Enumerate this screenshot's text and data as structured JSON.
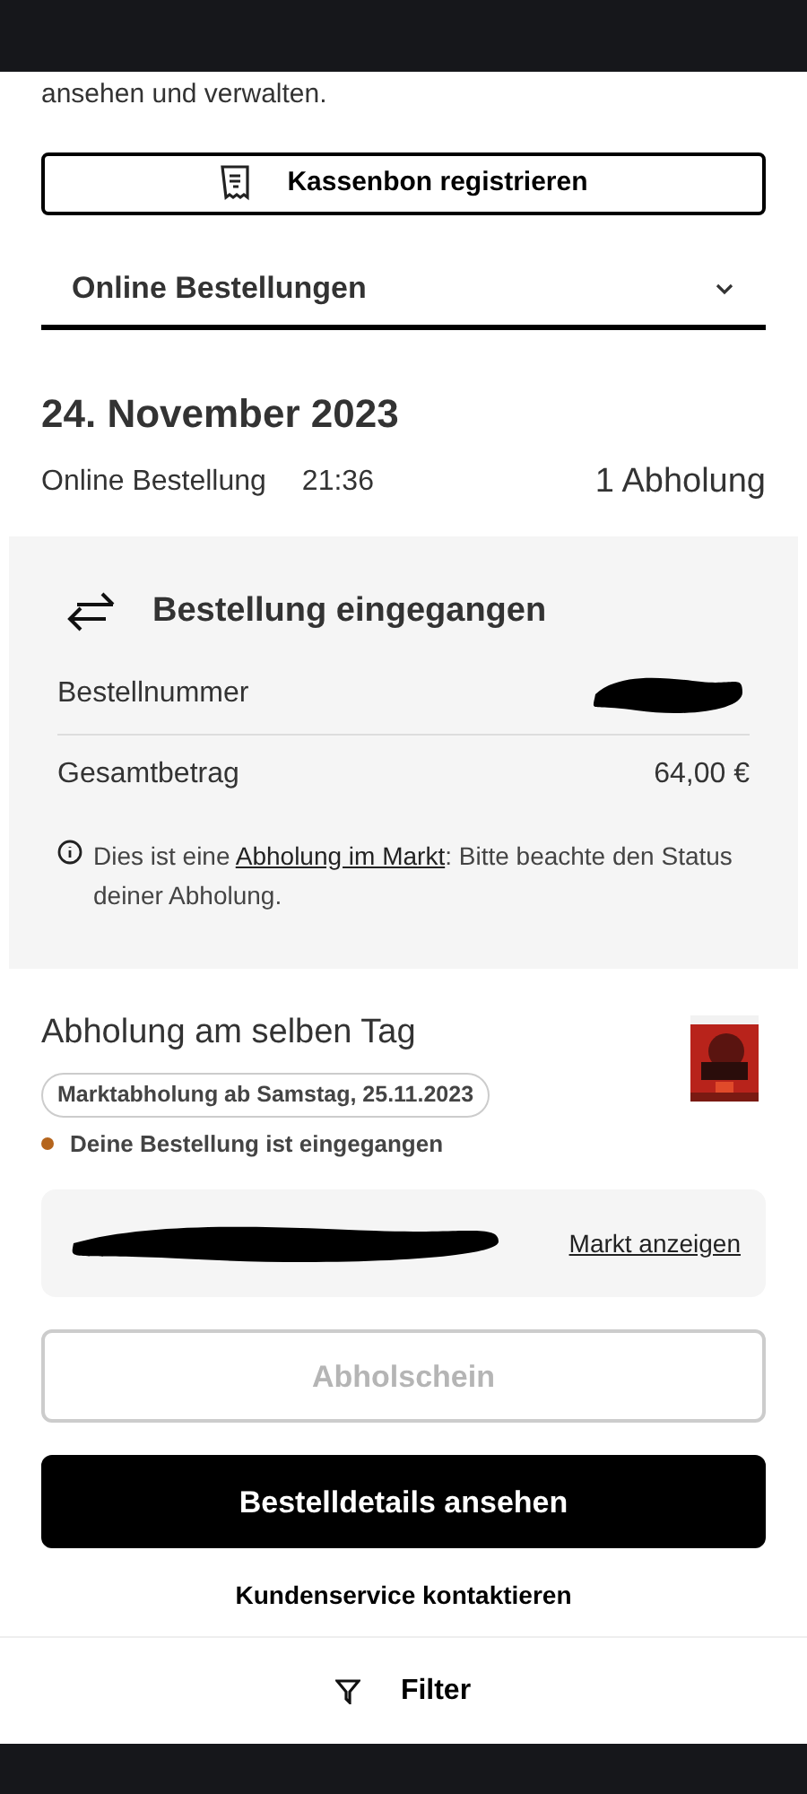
{
  "intro_text": "ansehen und verwalten.",
  "receipt_button": {
    "label": "Kassenbon registrieren"
  },
  "order_type_dropdown": {
    "value": "Online Bestellungen",
    "expanded": false
  },
  "order": {
    "date": "24. November 2023",
    "type": "Online Bestellung",
    "time": "21:36",
    "pickup_count": "1 Abholung",
    "status_card": {
      "title": "Bestellung eingegangen",
      "rows": [
        {
          "label": "Bestellnummer",
          "redacted": true
        },
        {
          "label": "Gesamtbetrag",
          "value": "64,00 €"
        }
      ],
      "info_before": "Dies ist eine ",
      "info_link": "Abholung im Markt",
      "info_after": ": Bitte beachte den Status deiner Abholung."
    },
    "pickup": {
      "title": "Abholung am selben Tag",
      "badge": "Marktabholung ab Samstag, 25.11.2023",
      "status": {
        "text": "Deine Bestellung ist eingegangen",
        "color": "#b5651d"
      }
    },
    "store": {
      "address_redacted": true,
      "link": "Markt anzeigen"
    },
    "buttons": [
      {
        "label": "Abholschein",
        "kind": "secondary",
        "disabled": true
      },
      {
        "label": "Bestelldetails ansehen",
        "kind": "primary",
        "disabled": false
      }
    ],
    "contact_link": "Kundenservice kontaktieren"
  },
  "filter_bar": {
    "label": "Filter"
  }
}
